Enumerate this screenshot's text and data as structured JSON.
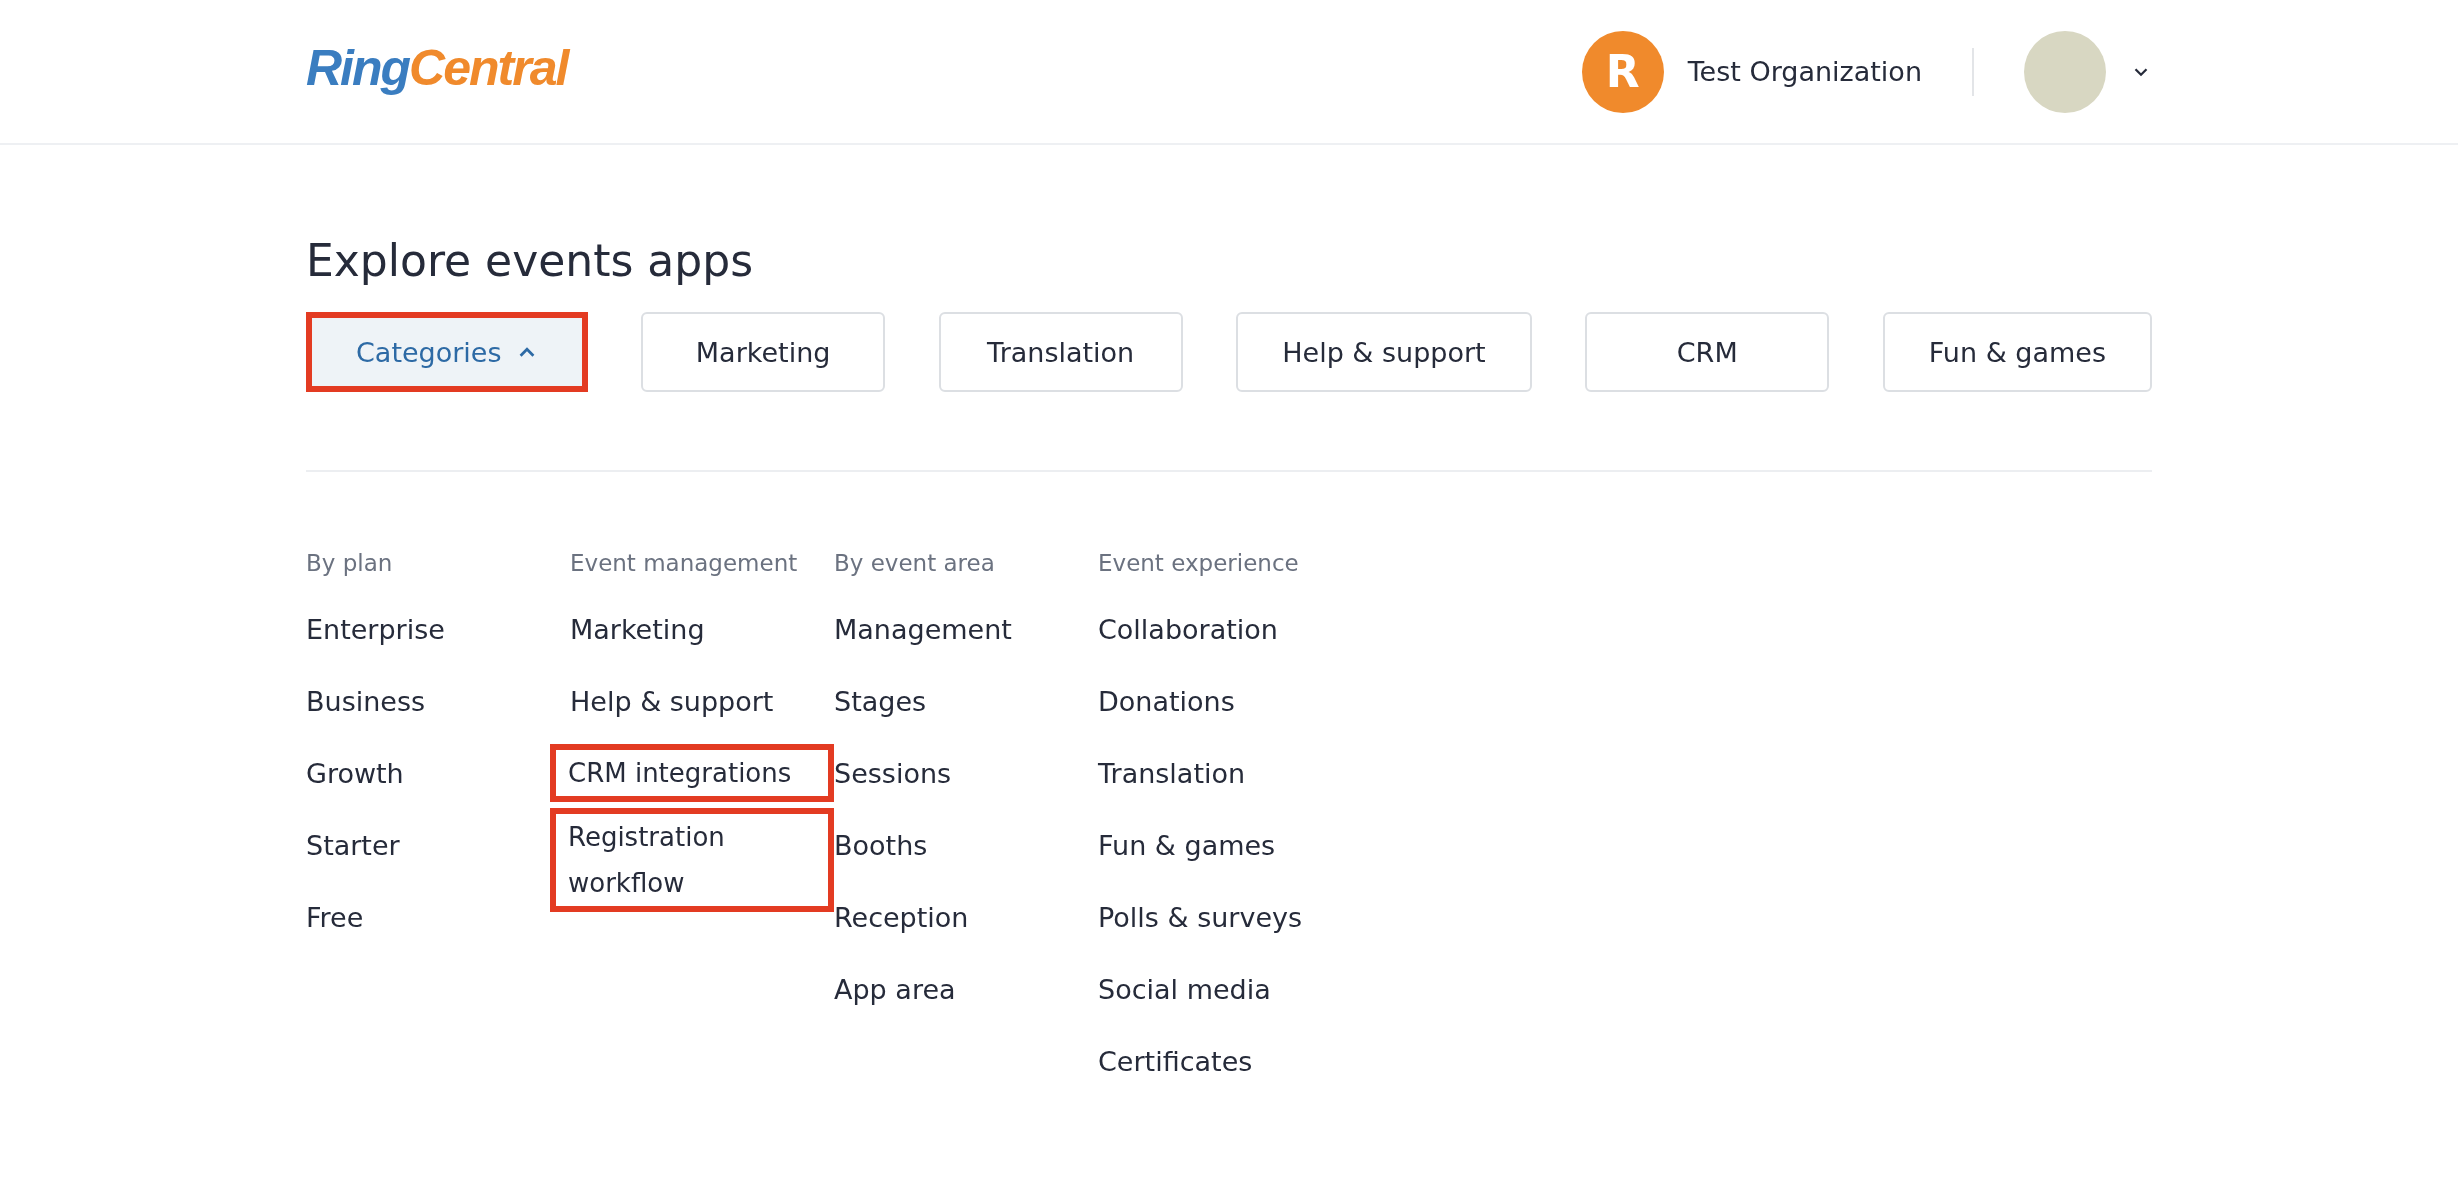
{
  "header": {
    "logo": {
      "first": "Ring",
      "second": "Central"
    },
    "organization": {
      "initial": "R",
      "name": "Test Organization"
    },
    "user_menu": {
      "expanded": false
    }
  },
  "title": "Explore events apps",
  "filters": [
    {
      "label": "Categories",
      "kind": "dropdown",
      "expanded": true,
      "highlighted": true
    },
    {
      "label": "Marketing",
      "kind": "chip",
      "highlighted": false
    },
    {
      "label": "Translation",
      "kind": "chip",
      "highlighted": false
    },
    {
      "label": "Help & support",
      "kind": "chip",
      "highlighted": false
    },
    {
      "label": "CRM",
      "kind": "chip",
      "highlighted": false
    },
    {
      "label": "Fun & games",
      "kind": "chip",
      "highlighted": false
    }
  ],
  "category_groups": [
    {
      "heading": "By plan",
      "items": [
        {
          "label": "Enterprise",
          "highlighted": false
        },
        {
          "label": "Business",
          "highlighted": false
        },
        {
          "label": "Growth",
          "highlighted": false
        },
        {
          "label": "Starter",
          "highlighted": false
        },
        {
          "label": "Free",
          "highlighted": false
        }
      ]
    },
    {
      "heading": "Event management",
      "items": [
        {
          "label": "Marketing",
          "highlighted": false
        },
        {
          "label": "Help & support",
          "highlighted": false
        },
        {
          "label": "CRM integrations",
          "highlighted": true
        },
        {
          "label": "Registration workflow",
          "highlighted": true
        }
      ]
    },
    {
      "heading": "By event area",
      "items": [
        {
          "label": "Management",
          "highlighted": false
        },
        {
          "label": "Stages",
          "highlighted": false
        },
        {
          "label": "Sessions",
          "highlighted": false
        },
        {
          "label": "Booths",
          "highlighted": false
        },
        {
          "label": "Reception",
          "highlighted": false
        },
        {
          "label": "App area",
          "highlighted": false
        }
      ]
    },
    {
      "heading": "Event experience",
      "items": [
        {
          "label": "Collaboration",
          "highlighted": false
        },
        {
          "label": "Donations",
          "highlighted": false
        },
        {
          "label": "Translation",
          "highlighted": false
        },
        {
          "label": "Fun & games",
          "highlighted": false
        },
        {
          "label": "Polls & surveys",
          "highlighted": false
        },
        {
          "label": "Social media",
          "highlighted": false
        },
        {
          "label": "Certificates",
          "highlighted": false
        }
      ]
    }
  ]
}
